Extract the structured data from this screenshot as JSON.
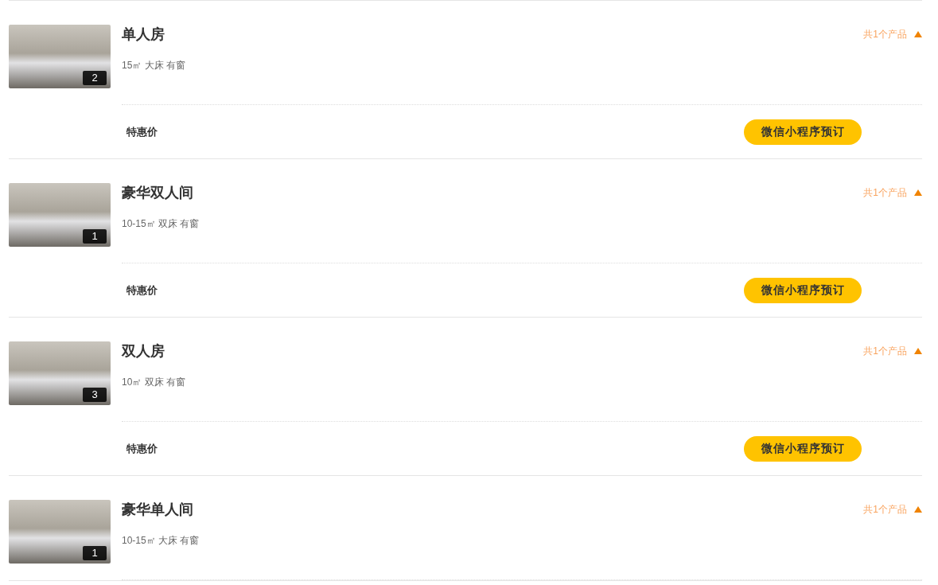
{
  "rooms": [
    {
      "title": "单人房",
      "details": "15㎡ 大床 有窗",
      "photo_count": "2",
      "product_count": "共1个产品",
      "expanded": true,
      "offer": {
        "label": "特惠价",
        "button": "微信小程序预订"
      }
    },
    {
      "title": "豪华双人间",
      "details": "10-15㎡ 双床 有窗",
      "photo_count": "1",
      "product_count": "共1个产品",
      "expanded": true,
      "offer": {
        "label": "特惠价",
        "button": "微信小程序预订"
      }
    },
    {
      "title": "双人房",
      "details": "10㎡ 双床 有窗",
      "photo_count": "3",
      "product_count": "共1个产品",
      "expanded": true,
      "offer": {
        "label": "特惠价",
        "button": "微信小程序预订"
      }
    },
    {
      "title": "豪华单人间",
      "details": "10-15㎡ 大床 有窗",
      "photo_count": "1",
      "product_count": "共1个产品",
      "expanded": true
    }
  ]
}
